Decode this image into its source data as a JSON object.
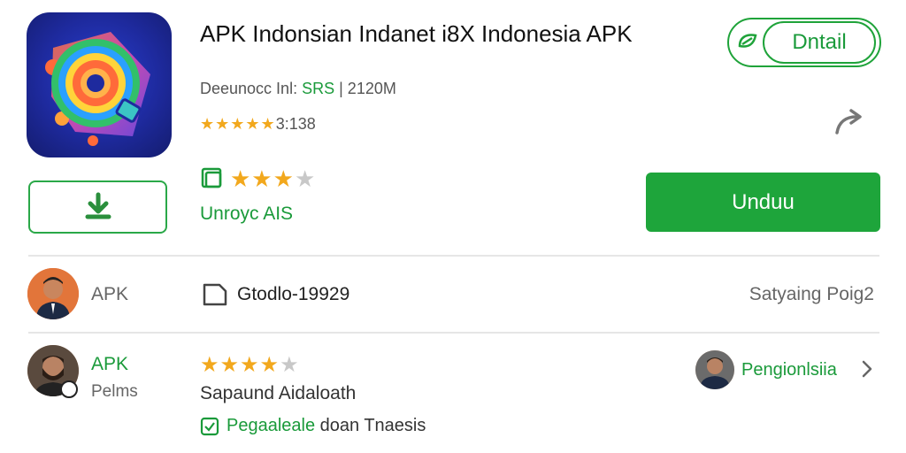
{
  "app": {
    "title": "APK Indonsian Indanet i8X Indonesia APK",
    "developer_label": "Deeunocc Inl:",
    "developer_highlight": "SRS",
    "size": "| 2120M",
    "stars": "★★★★★",
    "rating_count": "3:138"
  },
  "actions": {
    "detail_label": "Dntail",
    "unduh_label": "Unduu"
  },
  "rating2": {
    "stars_on": "★★★",
    "stars_off": "★",
    "label": "Unroyc AIS"
  },
  "row1": {
    "name": "APK",
    "file_label": "Gtodlo-19929",
    "right_label": "Satyaing Poig2"
  },
  "row2": {
    "name": "APK",
    "sub": "Pelms",
    "stars_on": "★★★★",
    "stars_off": "★",
    "desc": "Sapaund Aidaloath",
    "check_text_green": "Pegaaleale",
    "check_text_rest": " doan Tnaesis",
    "right_label": "Pengionlsiia"
  },
  "colors": {
    "accent": "#1ea53b",
    "star": "#f2a81d"
  }
}
